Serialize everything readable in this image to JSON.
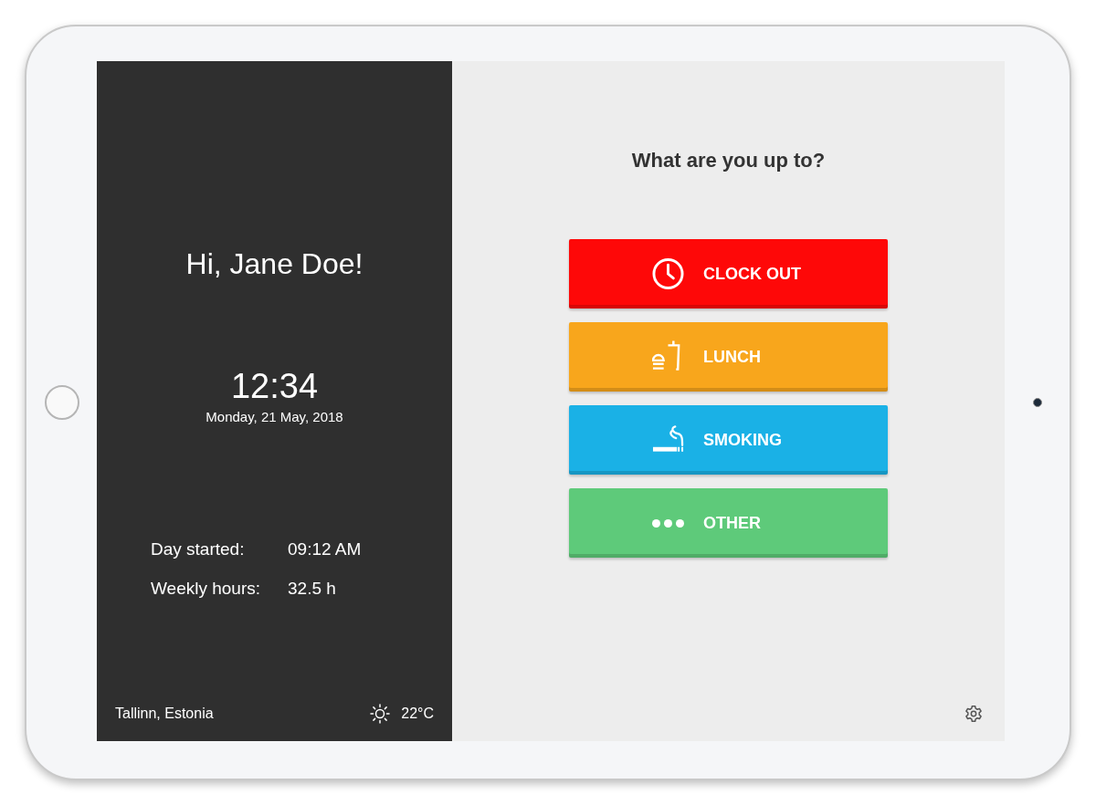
{
  "greeting": "Hi, Jane Doe!",
  "clock": {
    "time": "12:34",
    "date": "Monday, 21 May, 2018"
  },
  "stats": [
    {
      "label": "Day started:",
      "value": "09:12 AM"
    },
    {
      "label": "Weekly hours:",
      "value": "32.5 h"
    }
  ],
  "footer": {
    "location": "Tallinn, Estonia",
    "temperature": "22°C"
  },
  "prompt": "What are you up to?",
  "actions": [
    {
      "kind": "clock",
      "label": "CLOCK OUT",
      "color": "#fe0808"
    },
    {
      "kind": "lunch",
      "label": "LUNCH",
      "color": "#f8a61c"
    },
    {
      "kind": "smoking",
      "label": "SMOKING",
      "color": "#1ab1e6"
    },
    {
      "kind": "other",
      "label": "OTHER",
      "color": "#5eca7a"
    }
  ]
}
